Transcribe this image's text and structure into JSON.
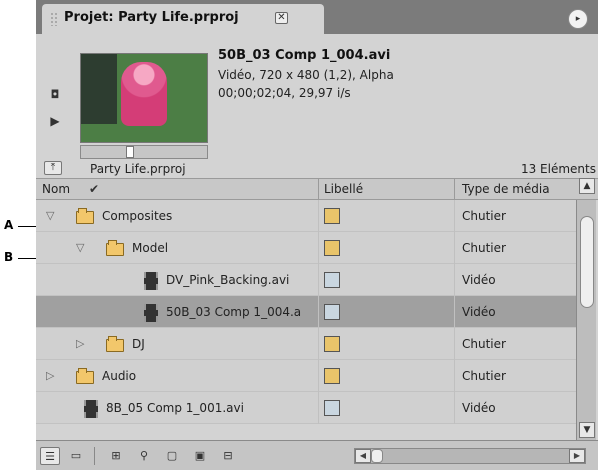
{
  "callouts": {
    "a": "A",
    "b": "B"
  },
  "panel": {
    "title": "Projet: Party Life.prproj",
    "close_glyph": "✕",
    "menu_glyph": "▸"
  },
  "preview": {
    "clip_name": "50B_03 Comp 1_004.avi",
    "info_line1": "Vidéo, 720 x 480 (1,2), Alpha",
    "info_line2": "00;00;02;04, 29,97 i/s",
    "poster_glyph": "◘",
    "play_glyph": "▶",
    "scrub_position": 0.39
  },
  "path": {
    "up_glyph": "⤒",
    "project_name": "Party Life.prproj",
    "item_count": "13 Eléments"
  },
  "columns": {
    "name": "Nom",
    "label": "Libellé",
    "type": "Type de média",
    "sort_glyph": "✔"
  },
  "rows": [
    {
      "name": "Composites",
      "kind": "folder",
      "indent": 1,
      "twisty": "▽",
      "label_color": "#e9c46a",
      "type": "Chutier",
      "selected": false
    },
    {
      "name": "Model",
      "kind": "folder",
      "indent": 2,
      "twisty": "▽",
      "label_color": "#e9c46a",
      "type": "Chutier",
      "selected": false
    },
    {
      "name": "DV_Pink_Backing.avi",
      "kind": "clip",
      "indent": 3,
      "twisty": "",
      "label_color": "#c9d6e0",
      "type": "Vidéo",
      "selected": false
    },
    {
      "name": "50B_03 Comp 1_004.a",
      "kind": "clip",
      "indent": 3,
      "twisty": "",
      "label_color": "#c9d6e0",
      "type": "Vidéo",
      "selected": true
    },
    {
      "name": "DJ",
      "kind": "folder",
      "indent": 2,
      "twisty": "▷",
      "label_color": "#e9c46a",
      "type": "Chutier",
      "selected": false
    },
    {
      "name": "Audio",
      "kind": "folder",
      "indent": 1,
      "twisty": "▷",
      "label_color": "#e9c46a",
      "type": "Chutier",
      "selected": false
    },
    {
      "name": "8B_05 Comp 1_001.avi",
      "kind": "clip",
      "indent": 1,
      "twisty": "",
      "label_color": "#c9d6e0",
      "type": "Vidéo",
      "selected": false
    }
  ],
  "scrollbar": {
    "up_glyph": "▲",
    "down_glyph": "▼"
  },
  "toolbar": {
    "list_view_glyph": "☰",
    "icon_view_glyph": "▭",
    "automate_glyph": "⊞",
    "find_glyph": "⚲",
    "new_bin_glyph": "▢",
    "new_item_glyph": "▣",
    "clear_glyph": "⊟",
    "scroll_left_glyph": "◀",
    "scroll_right_glyph": "▶"
  },
  "colors": {
    "panel_bg": "#d3d3d3",
    "selected_row": "#a0a0a0",
    "folder_yellow": "#f2c76b",
    "bin_label": "#e9c46a",
    "clip_label": "#c9d6e0"
  }
}
